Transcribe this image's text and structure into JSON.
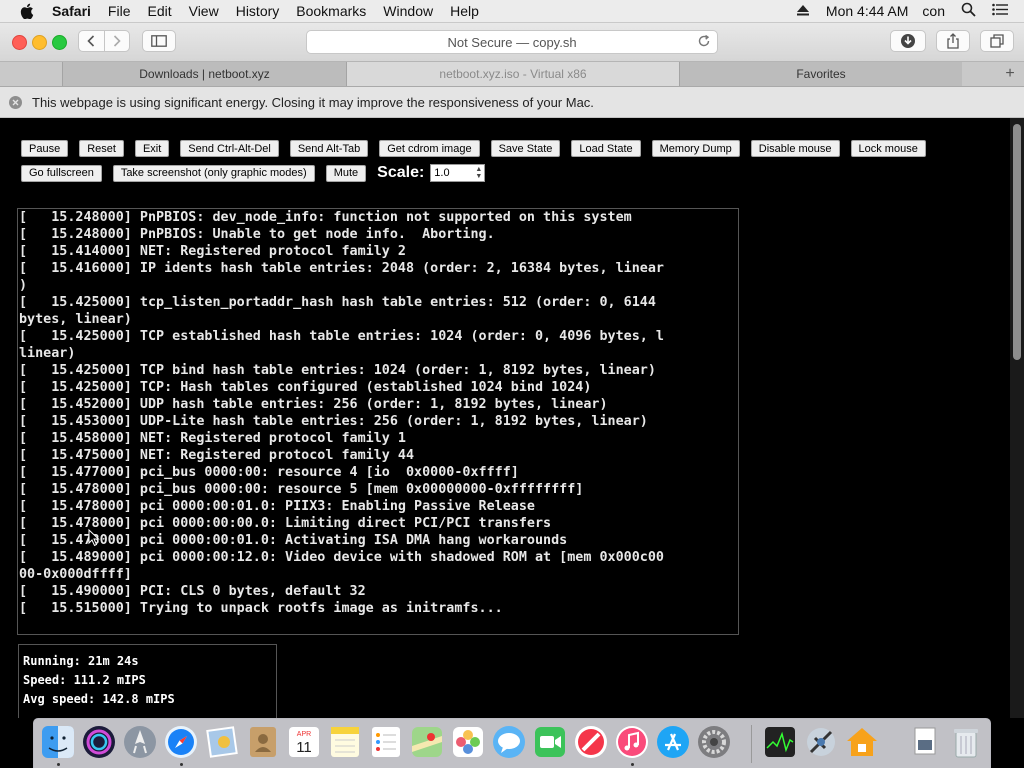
{
  "menubar": {
    "app_name": "Safari",
    "items": [
      "File",
      "Edit",
      "View",
      "History",
      "Bookmarks",
      "Window",
      "Help"
    ],
    "time": "Mon 4:44 AM",
    "user": "con"
  },
  "toolbar": {
    "url": "Not Secure — copy.sh"
  },
  "tabs": [
    {
      "title": "Downloads | netboot.xyz"
    },
    {
      "title": "netboot.xyz.iso - Virtual x86"
    },
    {
      "title": "Favorites"
    }
  ],
  "banner": {
    "text": "This webpage is using significant energy. Closing it may improve the responsiveness of your Mac."
  },
  "controls": {
    "row1": [
      "Pause",
      "Reset",
      "Exit",
      "Send Ctrl-Alt-Del",
      "Send Alt-Tab",
      "Get cdrom image",
      "Save State",
      "Load State",
      "Memory Dump",
      "Disable mouse",
      "Lock mouse"
    ],
    "row2": [
      "Go fullscreen",
      "Take screenshot (only graphic modes)",
      "Mute"
    ],
    "scale_label": "Scale:",
    "scale_value": "1.0"
  },
  "terminal": {
    "lines": [
      "[   15.248000] PnPBIOS: dev_node_info: function not supported on this system",
      "[   15.248000] PnPBIOS: Unable to get node info.  Aborting.",
      "[   15.414000] NET: Registered protocol family 2",
      "[   15.416000] IP idents hash table entries: 2048 (order: 2, 16384 bytes, linear",
      ")",
      "[   15.425000] tcp_listen_portaddr_hash hash table entries: 512 (order: 0, 6144",
      "bytes, linear)",
      "[   15.425000] TCP established hash table entries: 1024 (order: 0, 4096 bytes, l",
      "linear)",
      "[   15.425000] TCP bind hash table entries: 1024 (order: 1, 8192 bytes, linear)",
      "[   15.425000] TCP: Hash tables configured (established 1024 bind 1024)",
      "[   15.452000] UDP hash table entries: 256 (order: 1, 8192 bytes, linear)",
      "[   15.453000] UDP-Lite hash table entries: 256 (order: 1, 8192 bytes, linear)",
      "[   15.458000] NET: Registered protocol family 1",
      "[   15.475000] NET: Registered protocol family 44",
      "[   15.477000] pci_bus 0000:00: resource 4 [io  0x0000-0xffff]",
      "[   15.478000] pci_bus 0000:00: resource 5 [mem 0x00000000-0xffffffff]",
      "[   15.478000] pci 0000:00:01.0: PIIX3: Enabling Passive Release",
      "[   15.478000] pci 0000:00:00.0: Limiting direct PCI/PCI transfers",
      "[   15.478000] pci 0000:00:01.0: Activating ISA DMA hang workarounds",
      "[   15.489000] pci 0000:00:12.0: Video device with shadowed ROM at [mem 0x000c00",
      "00-0x000dffff]",
      "[   15.490000] PCI: CLS 0 bytes, default 32",
      "[   15.515000] Trying to unpack rootfs image as initramfs...",
      "",
      "_"
    ]
  },
  "stats": {
    "running": "Running: 21m 24s",
    "speed": "Speed: 111.2 mIPS",
    "avg_speed": "Avg speed: 142.8 mIPS"
  },
  "dock": {
    "icons": [
      "finder-icon",
      "siri-icon",
      "launchpad-icon",
      "safari-icon",
      "preview-icon",
      "contacts-icon",
      "calendar-icon",
      "notes-icon",
      "reminders-icon",
      "maps-icon",
      "photos-icon",
      "messages-icon",
      "facetime-icon",
      "news-icon",
      "music-icon",
      "app-store-icon",
      "system-preferences-icon",
      "activity-monitor-icon",
      "network-utility-icon",
      "home-icon",
      "documents-icon",
      "trash-icon"
    ],
    "calendar_month": "APR",
    "calendar_day": "11"
  },
  "colors": {
    "terminal_bg": "#000000",
    "terminal_fg": "#e8e8e8",
    "safari_accent": "#1a82f7"
  }
}
